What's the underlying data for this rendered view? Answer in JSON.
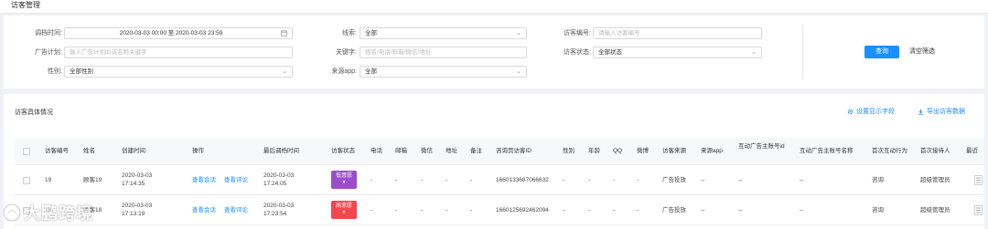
{
  "page": {
    "title": "访客管理"
  },
  "filters": {
    "last_edit_time": {
      "label": "调档时间:",
      "value": "2020-03-03 00:00 至 2020-03-03 23:59"
    },
    "clue": {
      "label": "线索:",
      "value": "全部"
    },
    "visitor_no": {
      "label": "访客编号:",
      "placeholder": "请输入访客编号"
    },
    "ad_plan": {
      "label": "广告计划:",
      "placeholder": "输入广告计划ID或名称关键字"
    },
    "keyword": {
      "label": "关键字:",
      "placeholder": "姓名/电话/邮箱/微信/地址"
    },
    "visitor_status": {
      "label": "访客状态:",
      "value": "全部状态"
    },
    "gender": {
      "label": "性别:",
      "value": "全部性别"
    },
    "source_app": {
      "label": "来源app:",
      "value": "全部"
    },
    "search_label": "查询",
    "reset_label": "清空筛选"
  },
  "table_section": {
    "title": "访客具体情况",
    "settings_label": "设置显示字段",
    "export_label": "导出访客数据"
  },
  "table": {
    "columns": [
      "访客编号",
      "姓名",
      "创建时间",
      "操作",
      "最后调档时间",
      "访客状态",
      "电话",
      "邮箱",
      "微信",
      "地址",
      "备注",
      "咨询页访客ID",
      "性别",
      "年龄",
      "QQ",
      "微博",
      "访客来源",
      "来源app",
      "互动广告主账号id",
      "互动广告主账号名称",
      "首次互动行为",
      "首次接待人",
      "最近"
    ],
    "rows": [
      {
        "id": "19",
        "name": "顾客19",
        "created_date": "2020-03-03",
        "created_time": "17:14:35",
        "action_session": "查看会话",
        "action_review": "查看评论",
        "last_date": "2020-03-03",
        "last_time": "17:24:05",
        "status": "低意愿",
        "status_color": "#9b4dca",
        "phone": "-",
        "email": "-",
        "wechat": "-",
        "address": "-",
        "remark": "-",
        "consult_id": "1660133687066632",
        "gender": "-",
        "age": "-",
        "qq": "-",
        "weibo": "-",
        "source": "广告投放",
        "source_app": "--",
        "adv_id": "--",
        "adv_name": "--",
        "first_action": "咨询",
        "first_receiver": "超级管理员"
      },
      {
        "id": "18",
        "name": "顾客18",
        "created_date": "2020-03-03",
        "created_time": "17:13:19",
        "action_session": "查看会话",
        "action_review": "查看评论",
        "last_date": "2020-03-03",
        "last_time": "17:23:54",
        "status": "高意愿",
        "status_color": "#f5454f",
        "phone": "-",
        "email": "-",
        "wechat": "-",
        "address": "-",
        "remark": "-",
        "consult_id": "1660125692462094",
        "gender": "-",
        "age": "-",
        "qq": "-",
        "weibo": "-",
        "source": "广告投放",
        "source_app": "--",
        "adv_id": "--",
        "adv_name": "--",
        "first_action": "咨询",
        "first_receiver": "超级管理员"
      }
    ]
  },
  "watermark": {
    "text": "大鹏跨境"
  },
  "colors": {
    "primary": "#1890ff",
    "low_intent": "#9b4dca",
    "high_intent": "#f5454f"
  },
  "icons": [
    "calendar-icon",
    "chevron-down-icon",
    "gear-icon",
    "download-icon",
    "menu-icon",
    "checkbox-icon",
    "watermark-logo-icon"
  ]
}
